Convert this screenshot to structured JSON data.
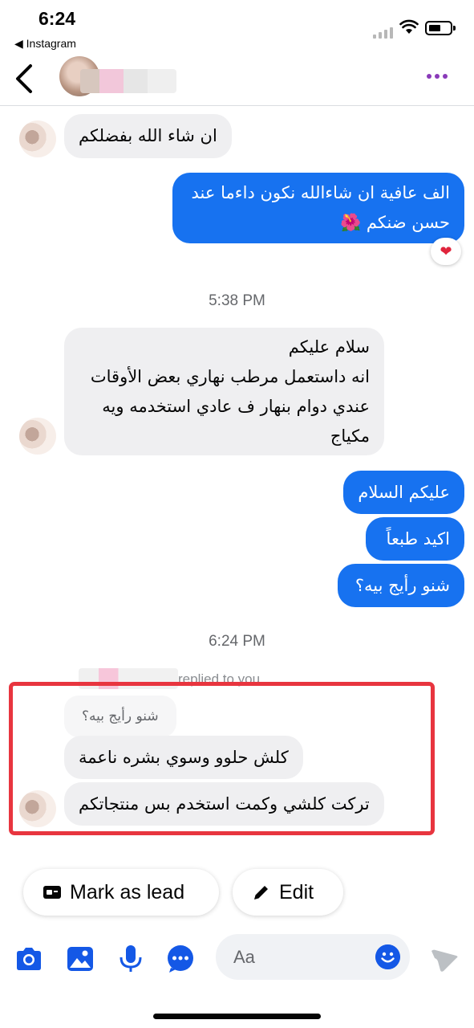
{
  "status_bar": {
    "time": "6:24",
    "back_app": "◀ Instagram"
  },
  "header": {
    "back_icon": "chevron-left-icon",
    "more_icon": "more-dots-icon",
    "accent": "#8a3ab9"
  },
  "messages": [
    {
      "side": "incoming",
      "text": "ان شاء الله بفضلكم"
    },
    {
      "side": "outgoing",
      "text": "الف عافية ان شاءالله نكون داءما عند\nحسن ضنكم 🌺",
      "reaction": "❤"
    },
    {
      "side": "incoming",
      "text": "سلام عليكم\nانه داستعمل مرطب نهاري بعض الأوقات\nعندي دوام بنهار ف عادي استخدمه ويه\nمكياج"
    },
    {
      "side": "outgoing",
      "text": "عليكم السلام"
    },
    {
      "side": "outgoing",
      "text": "اكيد طبعاً"
    },
    {
      "side": "outgoing",
      "text": "شنو رأيج بيه؟"
    },
    {
      "side": "incoming",
      "text": "كلش حلوو وسوي بشره ناعمة"
    },
    {
      "side": "incoming",
      "text": "تركت كلشي وكمت استخدم بس منتجاتكم"
    }
  ],
  "timestamps": [
    "5:38 PM",
    "6:24 PM"
  ],
  "reply": {
    "label": "replied to you",
    "quoted_text": "شنو رأيج بيه؟"
  },
  "actions": {
    "mark_lead": "Mark as lead",
    "edit": "Edit"
  },
  "composer": {
    "placeholder": "Aa"
  },
  "colors": {
    "outgoing_bubble": "#1772f0",
    "incoming_bubble": "#efeff1",
    "highlight": "#e8353f",
    "icon_blue": "#1458e6"
  }
}
